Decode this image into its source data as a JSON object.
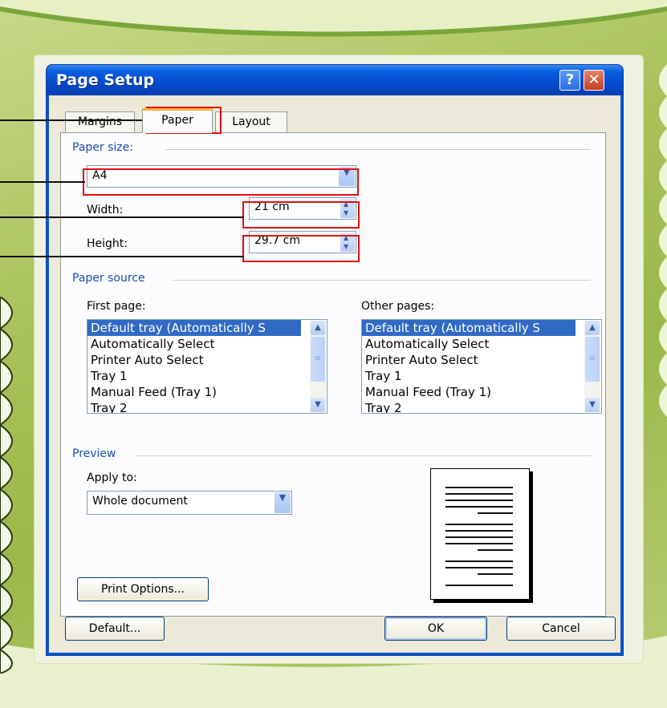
{
  "dialog": {
    "title": "Page Setup",
    "help_label": "?",
    "close_label": "✕"
  },
  "tabs": [
    {
      "label": "Margins",
      "active": false
    },
    {
      "label": "Paper",
      "active": true
    },
    {
      "label": "Layout",
      "active": false
    }
  ],
  "paper_size": {
    "group_label": "Paper size:",
    "selected": "A4",
    "width_label": "Width:",
    "width_value": "21 cm",
    "height_label": "Height:",
    "height_value": "29.7 cm"
  },
  "paper_source": {
    "group_label": "Paper source",
    "first_page_label": "First page:",
    "other_pages_label": "Other pages:",
    "first_page_items": [
      "Default tray (Automatically S",
      "Automatically Select",
      "Printer Auto Select",
      "Tray 1",
      "Manual Feed (Tray 1)",
      "Tray 2"
    ],
    "other_pages_items": [
      "Default tray (Automatically S",
      "Automatically Select",
      "Printer Auto Select",
      "Tray 1",
      "Manual Feed (Tray 1)",
      "Tray 2"
    ],
    "selected_index": 0
  },
  "preview": {
    "group_label": "Preview",
    "apply_to_label": "Apply to:",
    "apply_to_value": "Whole document"
  },
  "buttons": {
    "print_options": "Print Options...",
    "default": "Default...",
    "ok": "OK",
    "cancel": "Cancel"
  },
  "icons": {
    "dropdown": "chevron-down-icon",
    "spin": "spin-arrows-icon",
    "scroll_up": "chevron-up-icon",
    "scroll_down": "chevron-down-icon"
  },
  "colors": {
    "titlebar": "#0546c6",
    "dialog_face": "#ece9d8",
    "selection": "#316ac5",
    "active_tab_accent": "#f3b43c",
    "highlight_box": "#e01010",
    "background": "#a9c25a"
  }
}
